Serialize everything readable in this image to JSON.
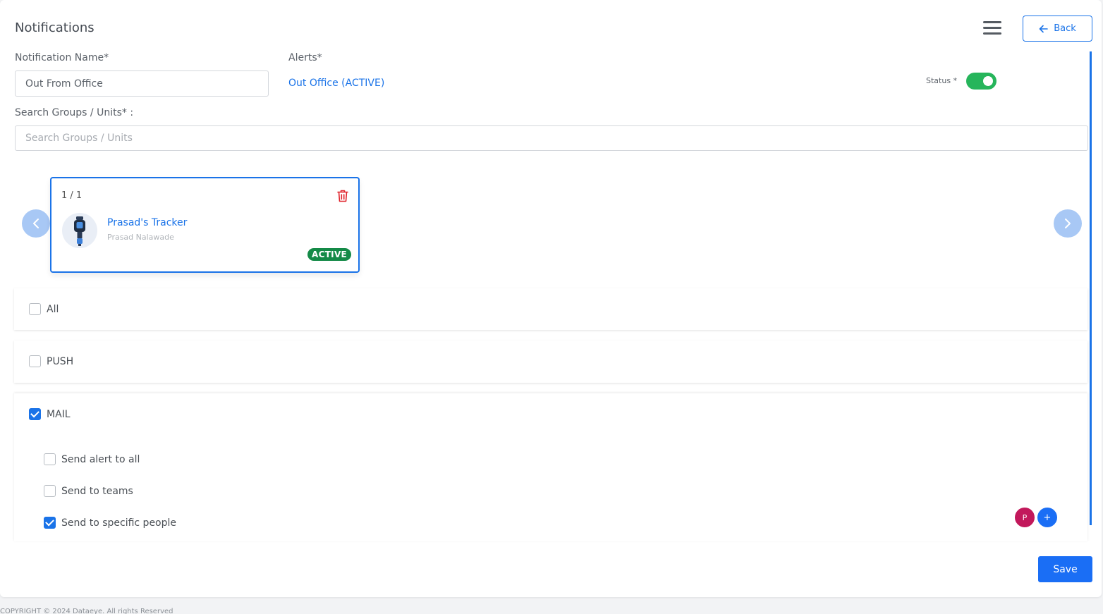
{
  "header": {
    "title": "Notifications",
    "back_label": "Back"
  },
  "form": {
    "notification_name_label": "Notification Name*",
    "notification_name_value": "Out From Office",
    "alerts_label": "Alerts*",
    "alerts_value": "Out Office (ACTIVE)",
    "status_label": "Status *",
    "status_on": true,
    "search_label": "Search Groups / Units* :",
    "search_placeholder": "Search Groups / Units"
  },
  "card": {
    "count": "1 / 1",
    "name": "Prasad's Tracker",
    "owner": "Prasad Nalawade",
    "status": "ACTIVE"
  },
  "channels": [
    {
      "label": "All",
      "checked": false
    },
    {
      "label": "PUSH",
      "checked": false
    },
    {
      "label": "MAIL",
      "checked": true
    }
  ],
  "mail_options": [
    {
      "label": "Send alert to all",
      "checked": false
    },
    {
      "label": "Send to teams",
      "checked": false
    },
    {
      "label": "Send to specific people",
      "checked": true
    }
  ],
  "people_chips": {
    "person_initial": "P",
    "add_label": "+"
  },
  "actions": {
    "save_label": "Save"
  },
  "footer": {
    "copyright": "COPYRIGHT © 2024 Dataeye. All rights Reserved"
  },
  "colors": {
    "accent": "#1a73e8",
    "toggle": "#26b55b",
    "badge": "#148a47",
    "delete": "#e0242c",
    "chip_person": "#c2185b"
  }
}
